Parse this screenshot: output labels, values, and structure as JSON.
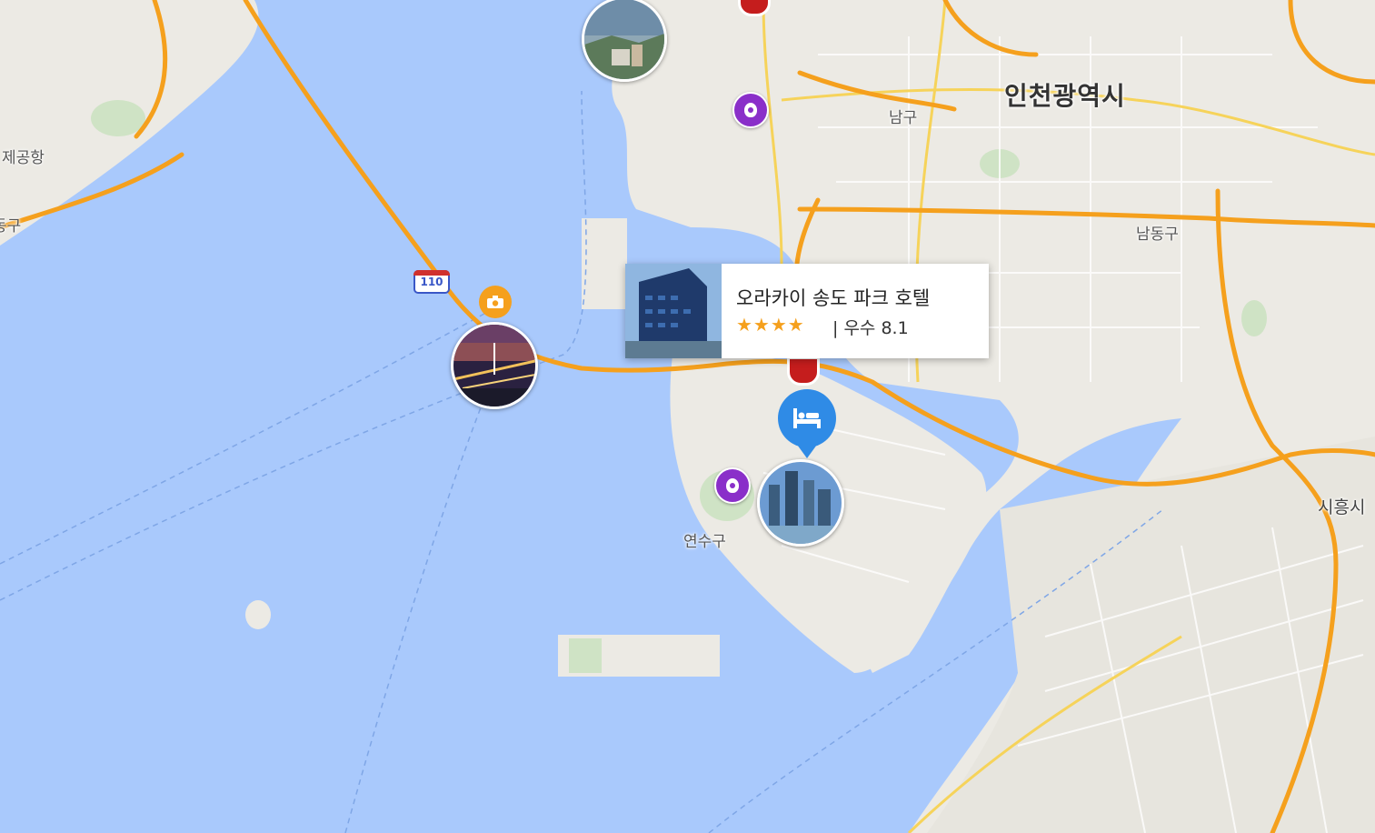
{
  "labels": {
    "city_incheon": "인천광역시",
    "district_namgu": "남구",
    "district_namdonggu": "남동구",
    "district_yeonsugu": "연수구",
    "city_siheung": "시흥시",
    "airport_partial": "제공항",
    "district_partial_left": "동구"
  },
  "road_shield": "110",
  "popup": {
    "title": "오라카이 송도 파크 호텔",
    "stars": "★★★★",
    "rating": "| 우수 8.1"
  },
  "icons": {
    "hotel": "bed-icon",
    "camera": "camera-icon",
    "poi": "lightbulb-icon"
  },
  "colors": {
    "water": "#a9c9fc",
    "land": "#eceae4",
    "highway": "#f5a01d",
    "poi_purple": "#8a2fc9",
    "hotel_blue": "#2f8be6"
  }
}
